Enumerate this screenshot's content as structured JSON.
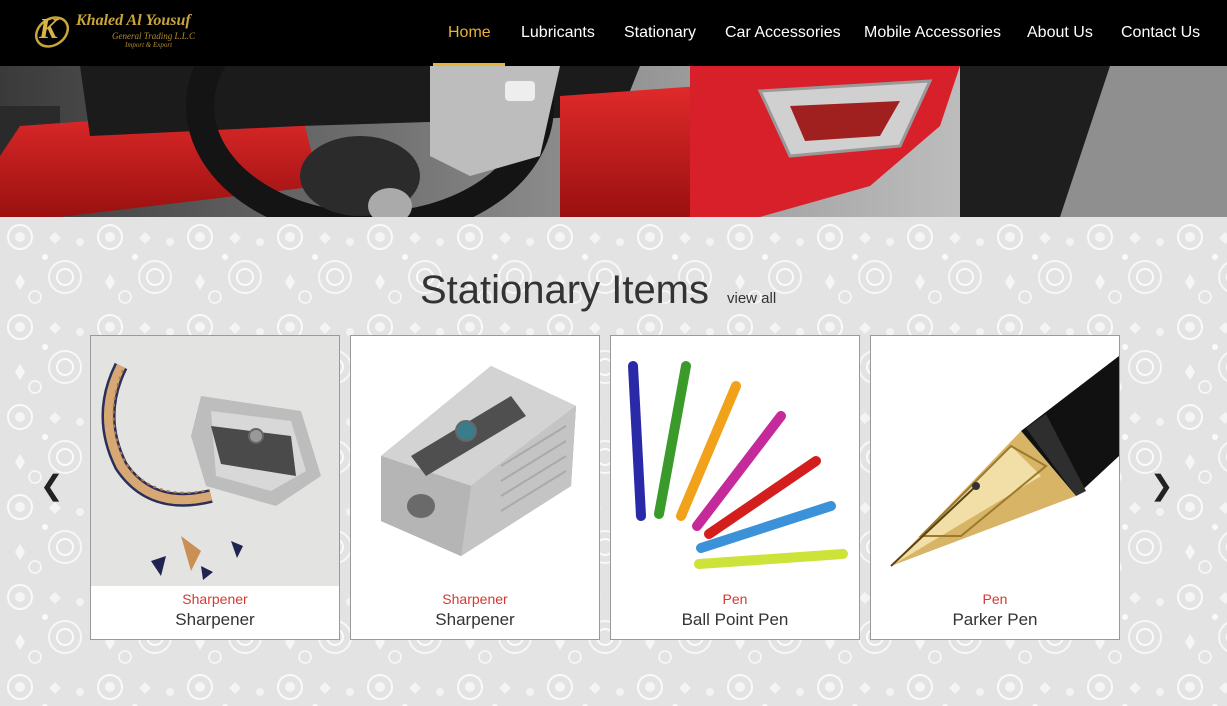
{
  "header": {
    "logo": {
      "title": "Khaled Al Yousuf",
      "subtitle": "General Trading L.L.C",
      "tagline": "Import & Export",
      "monogram": "K"
    },
    "nav": [
      {
        "label": "Home",
        "active": true
      },
      {
        "label": "Lubricants",
        "active": false
      },
      {
        "label": "Stationary",
        "active": false
      },
      {
        "label": "Car Accessories",
        "active": false
      },
      {
        "label": "Mobile Accessories",
        "active": false
      },
      {
        "label": "About Us",
        "active": false
      },
      {
        "label": "Contact Us",
        "active": false
      }
    ]
  },
  "section": {
    "title": "Stationary Items",
    "view_all": "view all",
    "prev_arrow": "❮",
    "next_arrow": "❯"
  },
  "products": [
    {
      "category": "Sharpener",
      "name": "Sharpener",
      "image": "pencil-sharpener-with-shavings"
    },
    {
      "category": "Sharpener",
      "name": "Sharpener",
      "image": "metal-sharpener"
    },
    {
      "category": "Pen",
      "name": "Ball Point Pen",
      "image": "colored-ballpoint-pens"
    },
    {
      "category": "Pen",
      "name": "Parker Pen",
      "image": "fountain-pen-nib"
    }
  ],
  "colors": {
    "accent": "#e5b23a",
    "category_red": "#d33a32",
    "header_bg": "#000000"
  }
}
